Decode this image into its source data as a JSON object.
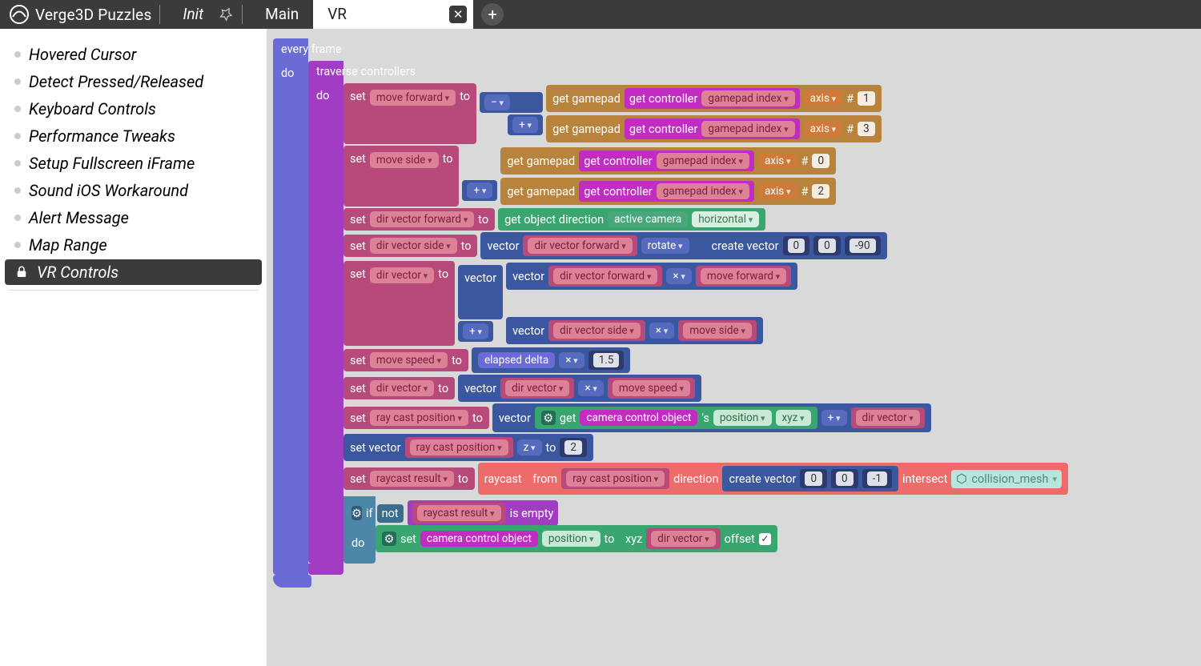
{
  "app_title": "Verge3D Puzzles",
  "tabs": {
    "init": "Init",
    "main": "Main",
    "active": "VR"
  },
  "sidebar": {
    "items": [
      "Hovered Cursor",
      "Detect Pressed/Released",
      "Keyboard Controls",
      "Performance Tweaks",
      "Setup Fullscreen iFrame",
      "Sound iOS Workaround",
      "Alert Message",
      "Map Range",
      "VR Controls"
    ],
    "active_index": 8
  },
  "txt": {
    "every_frame": "every frame",
    "do": "do",
    "traverse": "traverse controllers",
    "set": "set",
    "to": "to",
    "get_gamepad": "get gamepad",
    "get_controller": "get controller",
    "axis": "axis",
    "hash": "#",
    "get_obj_dir": "get object direction",
    "active_cam": "active camera",
    "horizontal": "horizontal",
    "vector": "vector",
    "rotate": "rotate",
    "create_vector": "create vector",
    "elapsed": "elapsed delta",
    "set_vector": "set vector",
    "raycast": "raycast",
    "from": "from",
    "direction": "direction",
    "intersect": "intersect",
    "if": "if",
    "not": "not",
    "is_empty": "is empty",
    "get": "get",
    "s": "'s",
    "position": "position",
    "xyz": "xyz",
    "offset": "offset",
    "z": "z"
  },
  "vars": {
    "move_forward": "move forward",
    "move_side": "move side",
    "dir_vec_fwd": "dir vector forward",
    "dir_vec_side": "dir vector side",
    "dir_vector": "dir vector",
    "move_speed": "move speed",
    "ray_pos": "ray cast position",
    "ray_res": "raycast result",
    "gp_idx": "gamepad index",
    "cam_ctrl": "camera control object",
    "collision": "collision_mesh"
  },
  "ops": {
    "minus": "−",
    "plus": "+",
    "times": "×"
  },
  "nums": {
    "axis1": "1",
    "axis3": "3",
    "axis0": "0",
    "axis2": "2",
    "v0": "0",
    "v0b": "0",
    "v_n90": "-90",
    "spd": "1.5",
    "sv_z": "2",
    "rv0": "0",
    "rv0b": "0",
    "rv_n1": "-1"
  }
}
